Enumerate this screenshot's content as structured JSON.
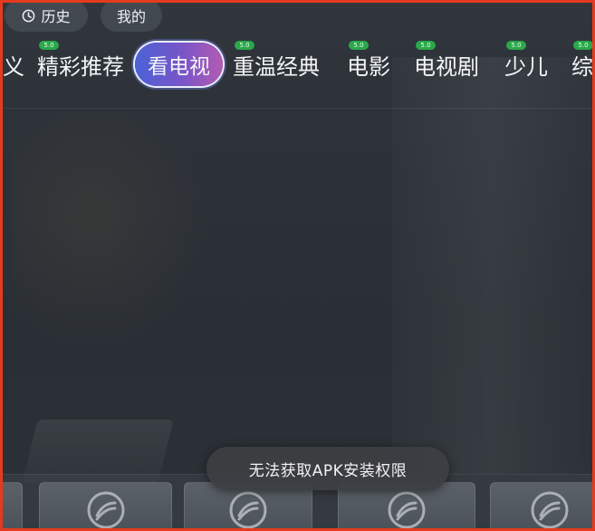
{
  "top_buttons": {
    "history_label": "历史",
    "mine_label": "我的"
  },
  "nav": {
    "tabs": [
      {
        "label": "义",
        "badge": ""
      },
      {
        "label": "精彩推荐",
        "badge": "5.0"
      },
      {
        "label": "看电视",
        "badge": ""
      },
      {
        "label": "重温经典",
        "badge": "5.0"
      },
      {
        "label": "电影",
        "badge": "5.0"
      },
      {
        "label": "电视剧",
        "badge": "5.0"
      },
      {
        "label": "少儿",
        "badge": "5.0"
      },
      {
        "label": "综",
        "badge": "5.0"
      }
    ],
    "active_index": 2
  },
  "toast": {
    "message": "无法获取APK安装权限"
  },
  "colors": {
    "frame_border": "#e63a1f",
    "active_tab_gradient_start": "#4a62d6",
    "active_tab_gradient_end": "#b45bb2",
    "badge_green": "#2aa84a",
    "background": "#2a2f35"
  },
  "icons": {
    "history": "clock-icon",
    "tile_placeholder": "brand-logo-icon"
  }
}
